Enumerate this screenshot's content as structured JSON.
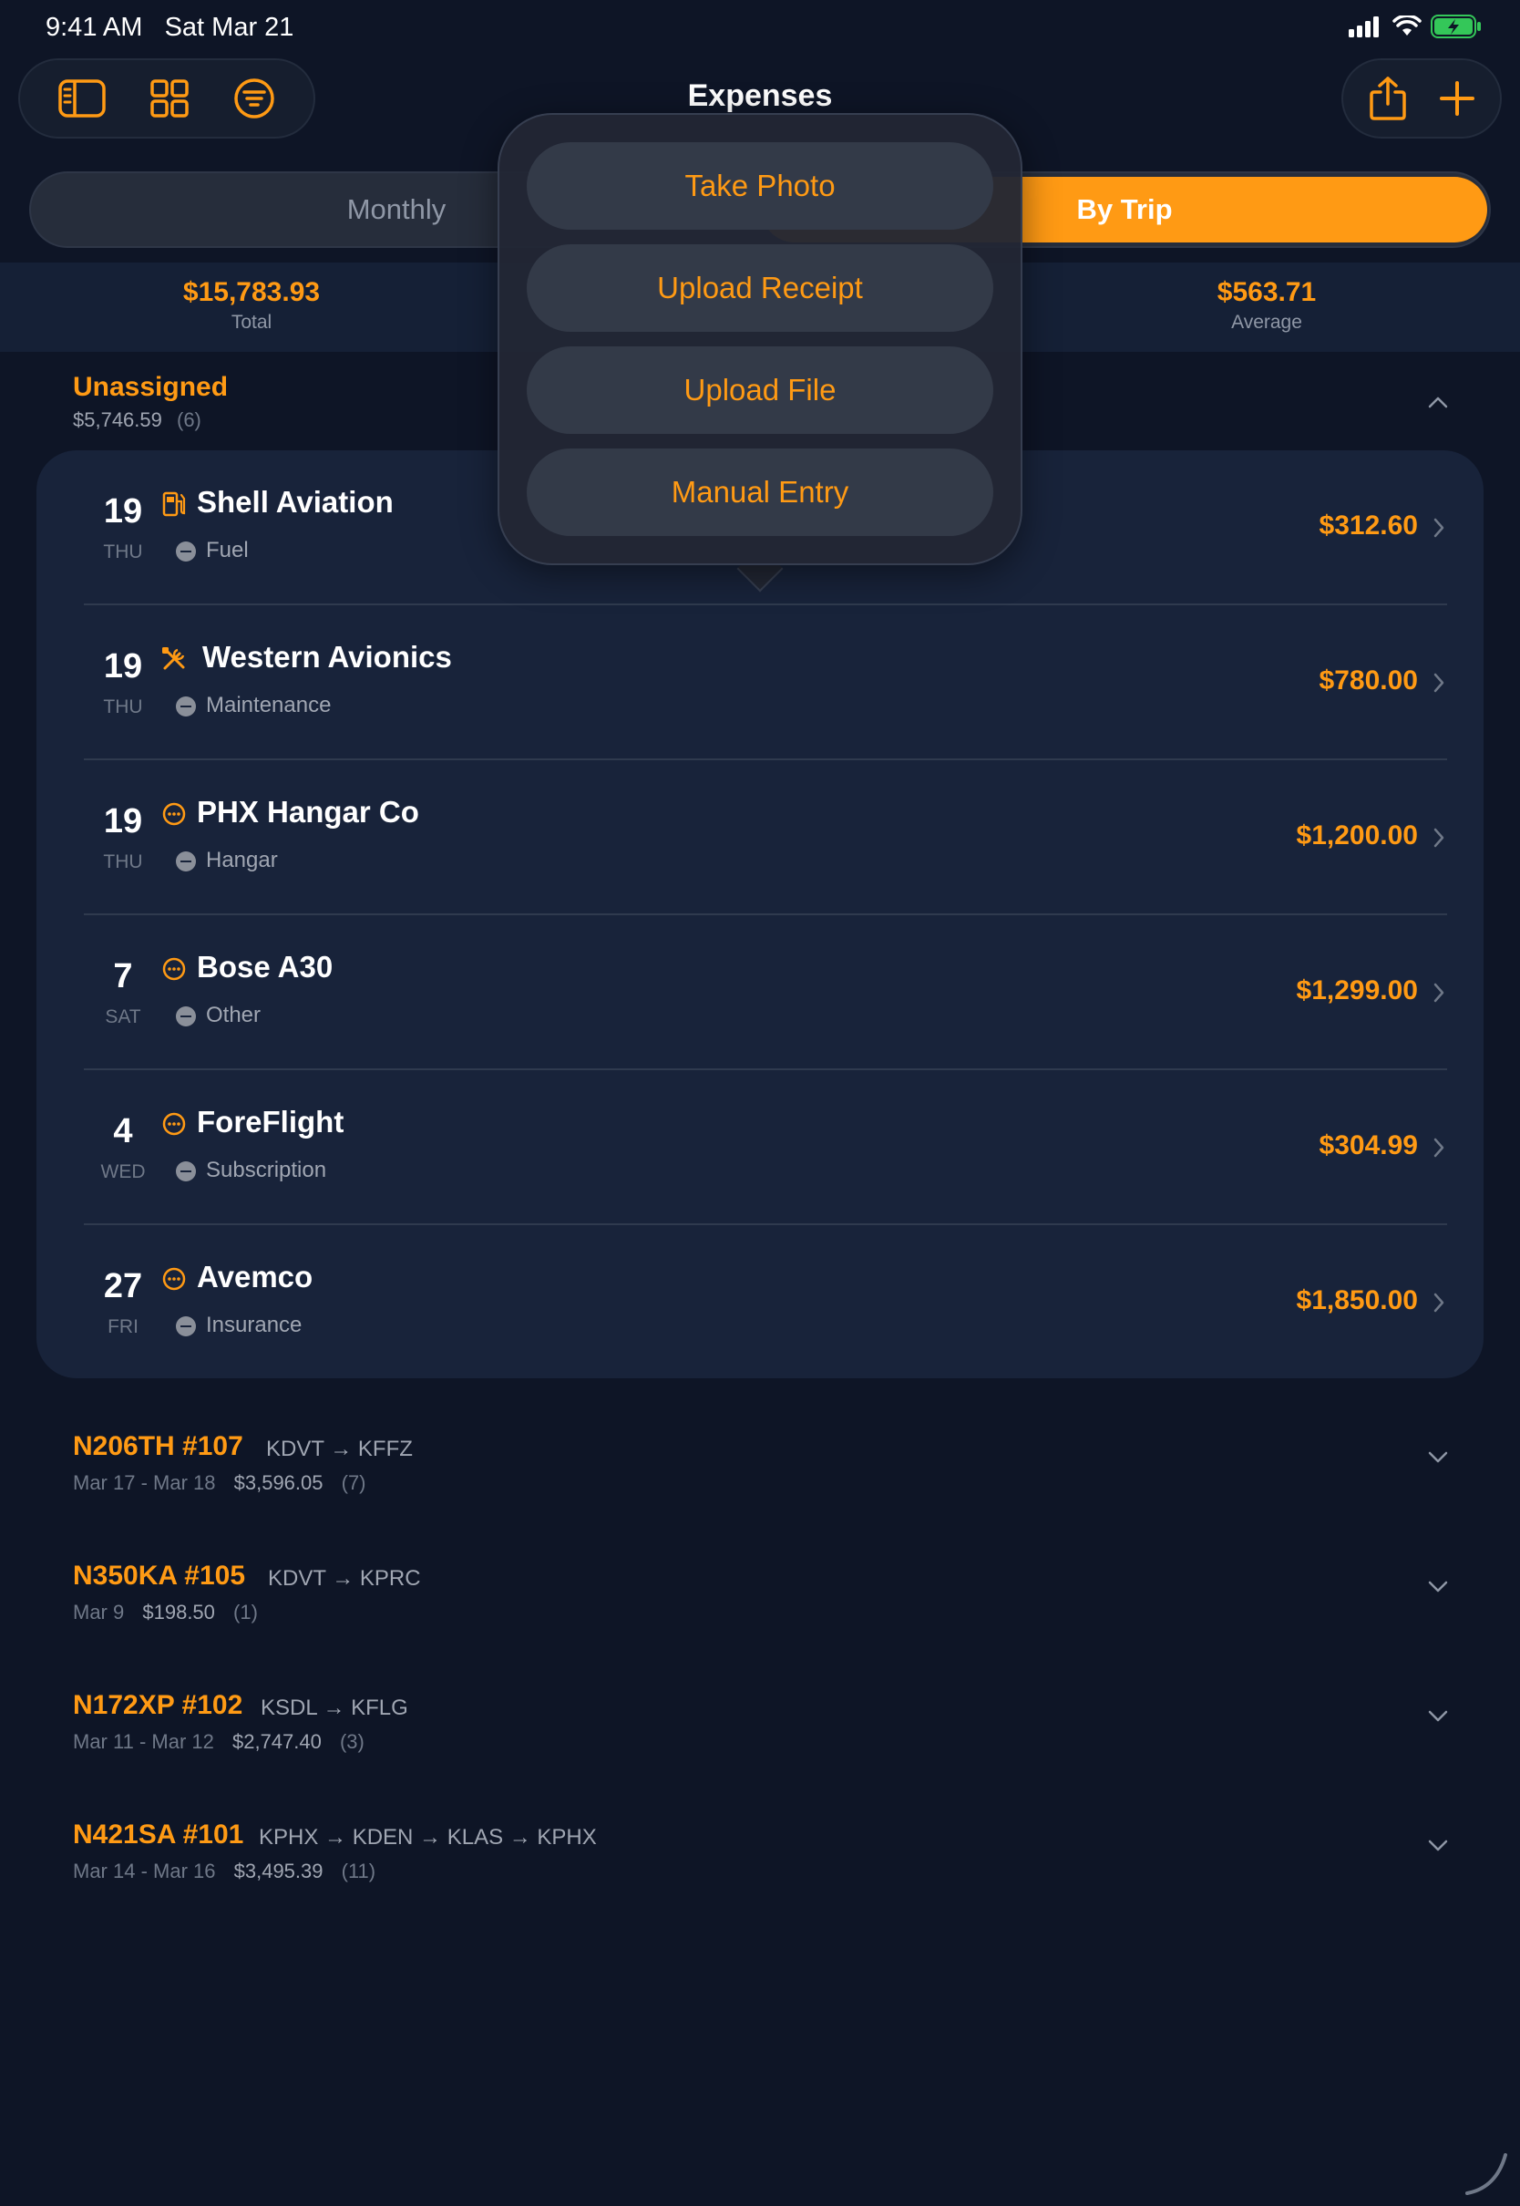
{
  "status_bar": {
    "time": "9:41 AM   Sat Mar 21"
  },
  "header": {
    "title": "Expenses",
    "left_icons": [
      "sidebar-icon",
      "grid-icon",
      "filter-icon"
    ],
    "right_icons": [
      "share-icon",
      "plus-icon"
    ]
  },
  "segments": {
    "monthly": "Monthly",
    "by_trip": "By Trip",
    "selected": "By Trip"
  },
  "summary": {
    "total_value": "$15,783.93",
    "total_label": "Total",
    "average_value": "$563.71",
    "average_label": "Average"
  },
  "unassigned": {
    "title": "Unassigned",
    "amount": "$5,746.59",
    "count": "(6)"
  },
  "expenses": [
    {
      "day": "19",
      "weekday": "THU",
      "vendor": "Shell Aviation",
      "icon": "fuel-pump-icon",
      "category": "Fuel",
      "amount": "$312.60"
    },
    {
      "day": "19",
      "weekday": "THU",
      "vendor": "Western Avionics",
      "icon": "wrench-screwdriver-icon",
      "category": "Maintenance",
      "amount": "$780.00"
    },
    {
      "day": "19",
      "weekday": "THU",
      "vendor": "PHX Hangar Co",
      "icon": "ellipsis-circle-icon",
      "category": "Hangar",
      "amount": "$1,200.00"
    },
    {
      "day": "7",
      "weekday": "SAT",
      "vendor": "Bose A30",
      "icon": "ellipsis-circle-icon",
      "category": "Other",
      "amount": "$1,299.00"
    },
    {
      "day": "4",
      "weekday": "WED",
      "vendor": "ForeFlight",
      "icon": "ellipsis-circle-icon",
      "category": "Subscription",
      "amount": "$304.99"
    },
    {
      "day": "27",
      "weekday": "FRI",
      "vendor": "Avemco",
      "icon": "ellipsis-circle-icon",
      "category": "Insurance",
      "amount": "$1,850.00"
    }
  ],
  "trips": [
    {
      "title": "N206TH #107",
      "route": "KDVT → KFFZ",
      "dates": "Mar 17 - Mar 18",
      "amount": "$3,596.05",
      "count": "(7)"
    },
    {
      "title": "N350KA #105",
      "route": "KDVT → KPRC",
      "dates": "Mar 9",
      "amount": "$198.50",
      "count": "(1)"
    },
    {
      "title": "N172XP #102",
      "route": "KSDL → KFLG",
      "dates": "Mar 11 - Mar 12",
      "amount": "$2,747.40",
      "count": "(3)"
    },
    {
      "title": "N421SA #101",
      "route": "KPHX → KDEN → KLAS → KPHX",
      "dates": "Mar 14 - Mar 16",
      "amount": "$3,495.39",
      "count": "(11)"
    }
  ],
  "popover": {
    "take_photo": "Take Photo",
    "upload_receipt": "Upload Receipt",
    "upload_file": "Upload File",
    "manual_entry": "Manual Entry"
  },
  "colors": {
    "accent": "#ff9a14",
    "background": "#0e1526",
    "card": "#18233a",
    "battery": "#34c759"
  }
}
